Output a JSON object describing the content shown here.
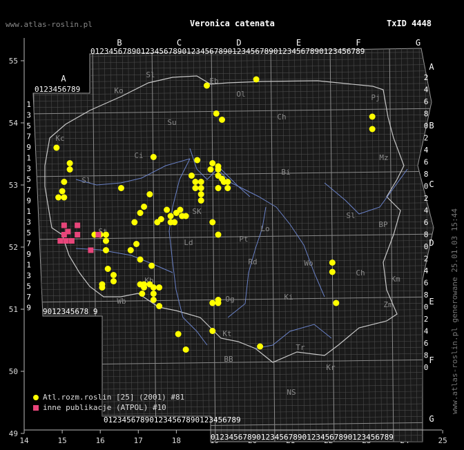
{
  "header": {
    "site": "www.atlas-roslin.pl",
    "title": "Veronica catenata",
    "taxid": "TxID 4448"
  },
  "side_note": "www.atlas-roslin.pl generowane 25.01.03 15:44",
  "axes": {
    "lon_ticks": [
      "14",
      "15",
      "16",
      "17",
      "18",
      "19",
      "20",
      "21",
      "22",
      "23",
      "24",
      "25"
    ],
    "lat_ticks": [
      "55",
      "54",
      "53",
      "52",
      "51",
      "50",
      "49"
    ]
  },
  "grid": {
    "top_col_letters": [
      "B",
      "C",
      "D",
      "E",
      "F",
      "G"
    ],
    "col_digits": "0123456789",
    "left_col_letter": "A",
    "left_row_digits": [
      "1",
      "3",
      "5",
      "7",
      "9",
      "1",
      "3",
      "5",
      "7",
      "9",
      "1",
      "3",
      "5",
      "7",
      "9",
      "1",
      "3",
      "5",
      "7",
      "9"
    ],
    "right_row_letters": [
      "A",
      "B",
      "C",
      "D",
      "E",
      "F",
      "G"
    ],
    "right_row_digits": [
      "2",
      "4",
      "6",
      "8",
      "0",
      "2",
      "4",
      "6",
      "8",
      "0",
      "2",
      "4",
      "6",
      "8",
      "0",
      "2",
      "4",
      "6",
      "8",
      "0",
      "2",
      "4",
      "6",
      "8",
      "0"
    ],
    "bottom_left_digits": "9012345678 9",
    "bottom_row_digits": "0123456789012345678901234567890123456789"
  },
  "regions": [
    "Sl",
    "Ko",
    "Eb",
    "Ol",
    "Ch",
    "Su",
    "Pj",
    "Ci",
    "Bi",
    "Mz",
    "Kc",
    "SK",
    "Lo",
    "Sl",
    "Ld",
    "Pt",
    "Rd",
    "Wo",
    "Ch",
    "BP",
    "Km",
    "Zm",
    "Kt",
    "Ki",
    "Tr",
    "BB",
    "NS",
    "Kr",
    "St",
    "Og",
    "Wb",
    "Kb",
    "Sl"
  ],
  "legend": [
    {
      "label": "Atl.rozm.roslin [25] (2001) #81",
      "color": "#ffff00",
      "shape": "circle"
    },
    {
      "label": "inne publikacje (ATPOL) #10",
      "color": "#e8457a",
      "shape": "square"
    }
  ],
  "points_yellow": [
    [
      18.8,
      54.6
    ],
    [
      20.1,
      54.7
    ],
    [
      19.05,
      54.15
    ],
    [
      19.2,
      54.05
    ],
    [
      14.85,
      53.6
    ],
    [
      15.2,
      53.35
    ],
    [
      15.2,
      53.25
    ],
    [
      17.4,
      53.45
    ],
    [
      18.55,
      53.4
    ],
    [
      18.95,
      53.35
    ],
    [
      19.1,
      53.3
    ],
    [
      19.1,
      53.25
    ],
    [
      18.9,
      53.25
    ],
    [
      19.1,
      53.15
    ],
    [
      19.2,
      53.1
    ],
    [
      18.4,
      53.15
    ],
    [
      15.05,
      53.05
    ],
    [
      15.0,
      52.9
    ],
    [
      14.9,
      52.8
    ],
    [
      15.05,
      52.8
    ],
    [
      16.55,
      52.95
    ],
    [
      17.3,
      52.85
    ],
    [
      18.5,
      53.05
    ],
    [
      18.5,
      52.95
    ],
    [
      18.65,
      53.05
    ],
    [
      18.65,
      52.95
    ],
    [
      18.65,
      52.85
    ],
    [
      18.65,
      52.75
    ],
    [
      19.25,
      53.05
    ],
    [
      19.35,
      53.05
    ],
    [
      19.35,
      52.95
    ],
    [
      19.1,
      52.95
    ],
    [
      17.15,
      52.65
    ],
    [
      17.05,
      52.55
    ],
    [
      17.75,
      52.6
    ],
    [
      17.85,
      52.5
    ],
    [
      17.6,
      52.45
    ],
    [
      17.5,
      52.4
    ],
    [
      17.85,
      52.4
    ],
    [
      17.95,
      52.4
    ],
    [
      18.1,
      52.6
    ],
    [
      18.0,
      52.55
    ],
    [
      18.15,
      52.5
    ],
    [
      18.25,
      52.5
    ],
    [
      16.9,
      52.4
    ],
    [
      18.95,
      52.4
    ],
    [
      19.1,
      52.2
    ],
    [
      15.85,
      52.2
    ],
    [
      16.0,
      52.2
    ],
    [
      16.15,
      52.2
    ],
    [
      16.15,
      52.1
    ],
    [
      16.15,
      51.95
    ],
    [
      16.8,
      51.95
    ],
    [
      16.95,
      52.05
    ],
    [
      17.05,
      51.8
    ],
    [
      17.35,
      51.7
    ],
    [
      16.2,
      51.65
    ],
    [
      16.35,
      51.55
    ],
    [
      16.35,
      51.45
    ],
    [
      16.05,
      51.4
    ],
    [
      16.05,
      51.35
    ],
    [
      17.05,
      51.4
    ],
    [
      17.15,
      51.4
    ],
    [
      17.15,
      51.35
    ],
    [
      17.3,
      51.4
    ],
    [
      17.4,
      51.35
    ],
    [
      17.55,
      51.35
    ],
    [
      17.1,
      51.25
    ],
    [
      17.4,
      51.25
    ],
    [
      17.4,
      51.15
    ],
    [
      17.55,
      51.05
    ],
    [
      18.95,
      51.1
    ],
    [
      19.1,
      51.15
    ],
    [
      19.1,
      51.1
    ],
    [
      22.1,
      51.75
    ],
    [
      22.1,
      51.6
    ],
    [
      22.2,
      51.1
    ],
    [
      23.15,
      54.1
    ],
    [
      23.15,
      53.9
    ],
    [
      18.05,
      50.6
    ],
    [
      18.95,
      50.65
    ],
    [
      18.25,
      50.35
    ],
    [
      20.2,
      50.4
    ]
  ],
  "points_pink": [
    [
      15.05,
      52.35
    ],
    [
      15.4,
      52.35
    ],
    [
      15.05,
      52.2
    ],
    [
      15.15,
      52.25
    ],
    [
      15.4,
      52.2
    ],
    [
      14.95,
      52.1
    ],
    [
      15.1,
      52.1
    ],
    [
      15.25,
      52.1
    ],
    [
      15.75,
      51.95
    ],
    [
      15.95,
      52.2
    ]
  ]
}
